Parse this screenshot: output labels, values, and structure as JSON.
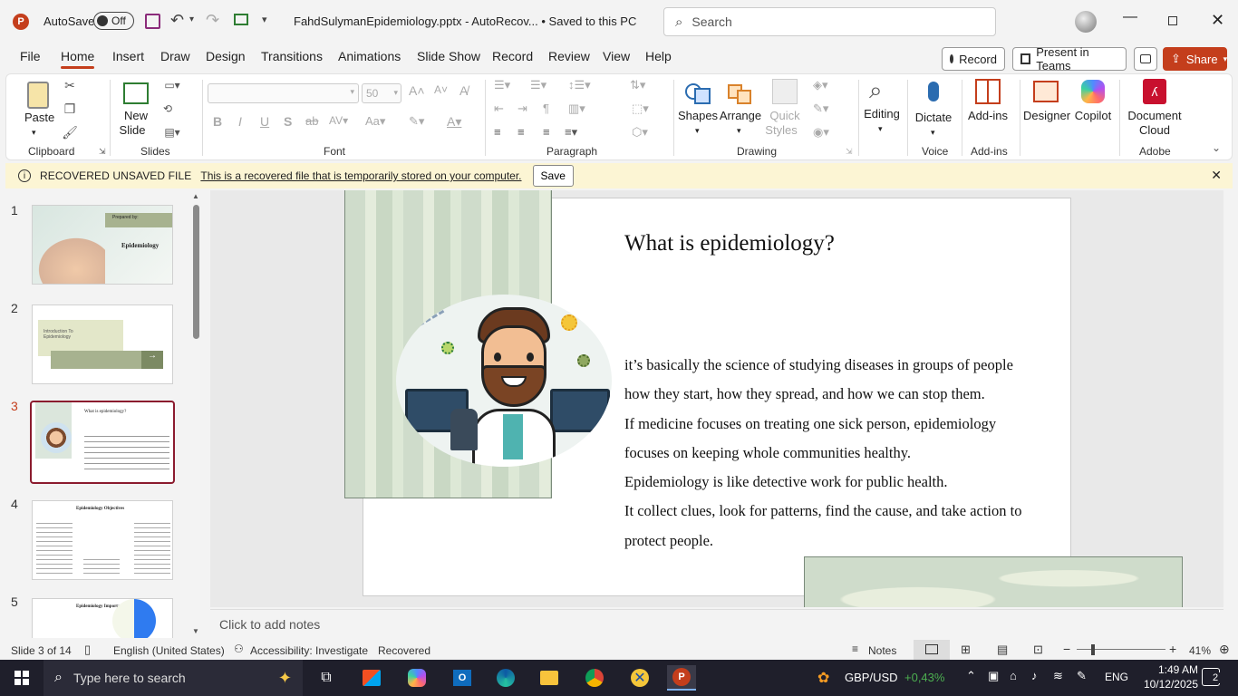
{
  "titlebar": {
    "autosave_label": "AutoSave",
    "autosave_state": "Off",
    "doc_title": "FahdSulymanEpidemiology.pptx  -  AutoRecov...  •  Saved to this PC",
    "search_placeholder": "Search"
  },
  "tabs": [
    "File",
    "Home",
    "Insert",
    "Draw",
    "Design",
    "Transitions",
    "Animations",
    "Slide Show",
    "Record",
    "Review",
    "View",
    "Help"
  ],
  "tab_buttons": {
    "record": "Record",
    "present": "Present in Teams",
    "share": "Share"
  },
  "ribbon": {
    "clipboard": {
      "paste": "Paste",
      "label": "Clipboard"
    },
    "slides": {
      "new_slide": "New",
      "new_slide2": "Slide",
      "label": "Slides"
    },
    "font": {
      "size": "50",
      "label": "Font"
    },
    "paragraph": {
      "label": "Paragraph"
    },
    "drawing": {
      "shapes": "Shapes",
      "arrange": "Arrange",
      "quick": "Quick",
      "quick2": "Styles",
      "label": "Drawing"
    },
    "editing": {
      "label": "Editing"
    },
    "voice": {
      "dictate": "Dictate",
      "label": "Voice"
    },
    "addins": {
      "addins": "Add-ins",
      "label": "Add-ins"
    },
    "designer": "Designer",
    "copilot": "Copilot",
    "adobe": {
      "doc": "Document",
      "cloud": "Cloud",
      "label": "Adobe"
    }
  },
  "infobar": {
    "title": "RECOVERED UNSAVED FILE",
    "message": "This is a recovered file that is temporarily stored on your computer.",
    "save": "Save"
  },
  "thumbnails": [
    {
      "num": "1",
      "title": "Epidemiology",
      "sub": "Prepared by:"
    },
    {
      "num": "2",
      "title": "Introduction To Epidemiology"
    },
    {
      "num": "3",
      "title": "What is epidemiology?"
    },
    {
      "num": "4",
      "title": "Epidemiology Objectives"
    },
    {
      "num": "5",
      "title": "Epidemiology Importance"
    }
  ],
  "slide": {
    "title": "What is epidemiology?",
    "body": [
      "it’s basically the science of studying diseases in groups of people",
      "how they start, how they spread, and how we can stop them.",
      "If medicine focuses on treating one sick person, epidemiology",
      "focuses on keeping whole communities healthy.",
      "Epidemiology is like detective work for public health.",
      "It collect clues, look for patterns, find the cause, and take action to",
      "protect people."
    ]
  },
  "notes_placeholder": "Click to add notes",
  "status": {
    "slide_count": "Slide 3 of 14",
    "language": "English (United States)",
    "accessibility": "Accessibility: Investigate",
    "recovered": "Recovered",
    "notes": "Notes",
    "zoom": "41%"
  },
  "taskbar": {
    "search": "Type here to search",
    "currency": "GBP/USD",
    "change": "+0,43%",
    "lang": "ENG",
    "time": "1:49 AM",
    "date": "10/12/2025",
    "notif": "2"
  },
  "colors": {
    "accent": "#c43e1c",
    "powerpoint": "#c43e1c",
    "infobar": "#fcf5d4",
    "slide_green": "#cfdccb"
  }
}
